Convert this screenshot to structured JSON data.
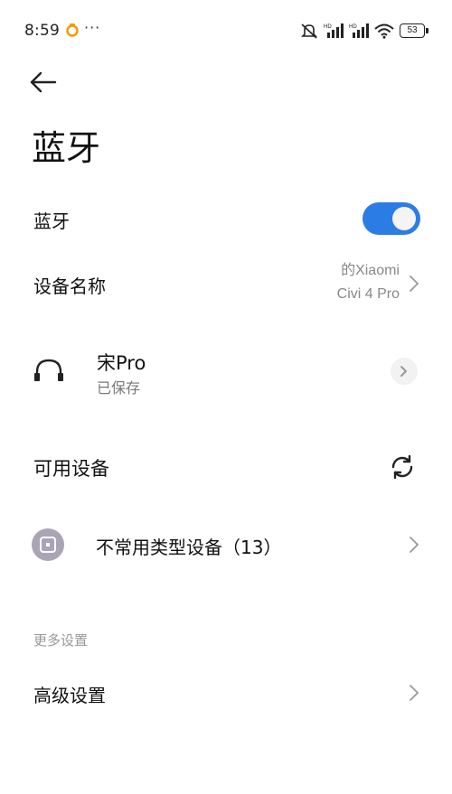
{
  "status_bar": {
    "time": "8:59",
    "more": "···",
    "signal_badge_1": "HD",
    "signal_badge_2": "HD",
    "battery": "53"
  },
  "header": {
    "title": "蓝牙"
  },
  "bluetooth_toggle": {
    "label": "蓝牙",
    "on": true,
    "accent_color": "#2c7ce5"
  },
  "device_name": {
    "label": "设备名称",
    "value_line1": "的Xiaomi",
    "value_line2": "Civi 4 Pro"
  },
  "saved_device": {
    "name": "宋Pro",
    "status": "已保存",
    "icon": "headphones-icon"
  },
  "available_devices": {
    "label": "可用设备",
    "icon": "refresh-icon"
  },
  "uncommon_devices": {
    "label": "不常用类型设备（13）",
    "icon": "device-type-icon",
    "icon_color": "#a9a4b6"
  },
  "more_settings": {
    "section_header": "更多设置",
    "advanced_label": "高级设置"
  }
}
